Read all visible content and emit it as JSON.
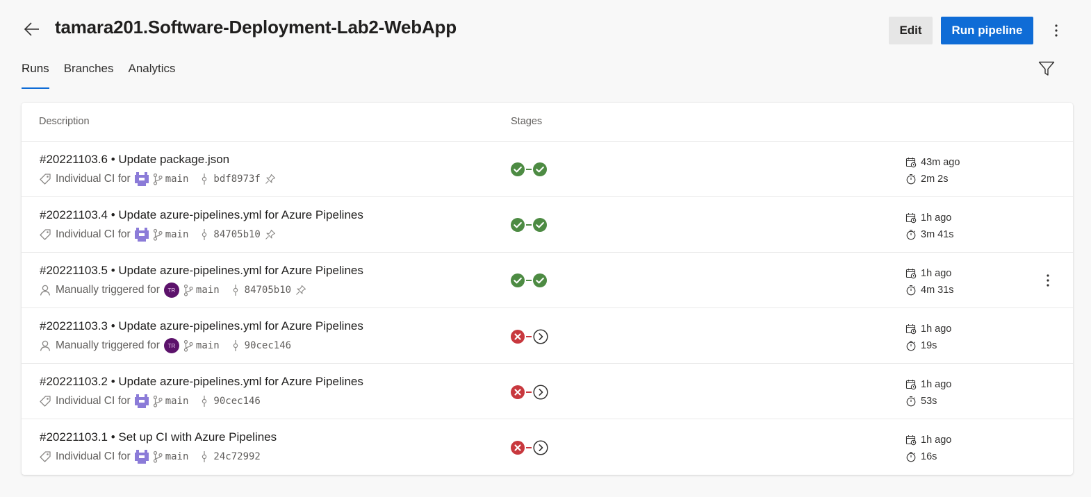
{
  "header": {
    "title": "tamara201.Software-Deployment-Lab2-WebApp",
    "edit_label": "Edit",
    "run_label": "Run pipeline",
    "accent_color": "#0f6cd6"
  },
  "tabs": [
    {
      "label": "Runs",
      "active": true
    },
    {
      "label": "Branches",
      "active": false
    },
    {
      "label": "Analytics",
      "active": false
    }
  ],
  "table": {
    "columns": {
      "description": "Description",
      "stages": "Stages"
    },
    "runs": [
      {
        "title": "#20221103.6 • Update package.json",
        "trigger_icon": "tag-icon",
        "trigger": "Individual CI for",
        "avatar": "identicon",
        "branch": "main",
        "commit": "bdf8973f",
        "pinned": true,
        "stages": [
          "succeeded",
          "succeeded"
        ],
        "started": "43m ago",
        "duration": "2m 2s"
      },
      {
        "title": "#20221103.4 • Update azure-pipelines.yml for Azure Pipelines",
        "trigger_icon": "tag-icon",
        "trigger": "Individual CI for",
        "avatar": "identicon",
        "branch": "main",
        "commit": "84705b10",
        "pinned": true,
        "stages": [
          "succeeded",
          "succeeded"
        ],
        "started": "1h ago",
        "duration": "3m 41s"
      },
      {
        "title": "#20221103.5 • Update azure-pipelines.yml for Azure Pipelines",
        "trigger_icon": "person-icon",
        "trigger": "Manually triggered for",
        "avatar": "initials",
        "avatar_initials": "TR",
        "branch": "main",
        "commit": "84705b10",
        "pinned": true,
        "stages": [
          "succeeded",
          "succeeded"
        ],
        "started": "1h ago",
        "duration": "4m 31s",
        "hovered": true
      },
      {
        "title": "#20221103.3 • Update azure-pipelines.yml for Azure Pipelines",
        "trigger_icon": "person-icon",
        "trigger": "Manually triggered for",
        "avatar": "initials",
        "avatar_initials": "TR",
        "branch": "main",
        "commit": "90cec146",
        "pinned": false,
        "stages": [
          "failed",
          "skipped"
        ],
        "started": "1h ago",
        "duration": "19s"
      },
      {
        "title": "#20221103.2 • Update azure-pipelines.yml for Azure Pipelines",
        "trigger_icon": "tag-icon",
        "trigger": "Individual CI for",
        "avatar": "identicon",
        "branch": "main",
        "commit": "90cec146",
        "pinned": false,
        "stages": [
          "failed",
          "skipped"
        ],
        "started": "1h ago",
        "duration": "53s"
      },
      {
        "title": "#20221103.1 • Set up CI with Azure Pipelines",
        "trigger_icon": "tag-icon",
        "trigger": "Individual CI for",
        "avatar": "identicon",
        "branch": "main",
        "commit": "24c72992",
        "pinned": false,
        "stages": [
          "failed",
          "skipped"
        ],
        "started": "1h ago",
        "duration": "16s"
      }
    ]
  },
  "colors": {
    "success": "#4d8b43",
    "failure": "#c8383e",
    "skipped": "#323130",
    "identicon": "#8b7bd8",
    "avatar_bg": "#5c126b"
  }
}
